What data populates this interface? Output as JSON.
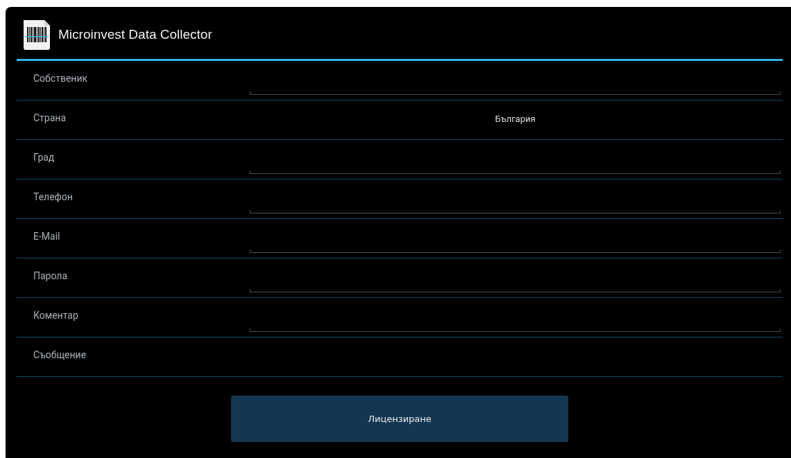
{
  "action_bar": {
    "title": "Microinvest Data Collector"
  },
  "form": {
    "rows": [
      {
        "kind": "field",
        "label": "Собственик"
      },
      {
        "kind": "value",
        "label": "Страна",
        "value": "България"
      },
      {
        "kind": "field",
        "label": "Град"
      },
      {
        "kind": "field",
        "label": "Телефон"
      },
      {
        "kind": "field",
        "label": "E-Mail"
      },
      {
        "kind": "field",
        "label": "Парола"
      },
      {
        "kind": "field",
        "label": "Коментар"
      },
      {
        "kind": "label",
        "label": "Съобщение"
      }
    ]
  },
  "button": {
    "label": "Лицензиране"
  }
}
